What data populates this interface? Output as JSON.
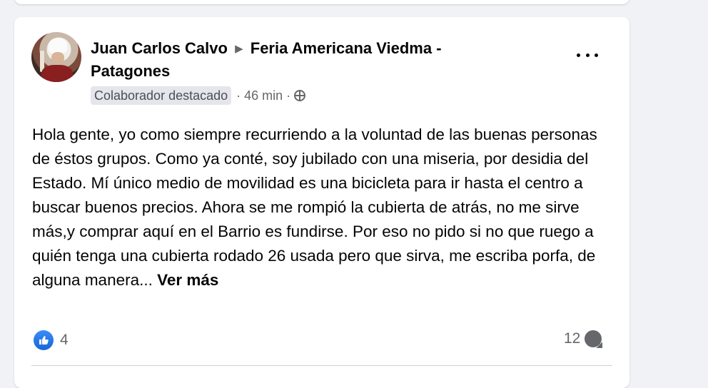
{
  "post": {
    "author": "Juan Carlos Calvo",
    "group": "Feria Americana Viedma - Patagones",
    "badge": "Colaborador destacado",
    "time": "· 46 min ·",
    "body": "Hola gente, yo como siempre recurriendo a la voluntad de las buenas personas de éstos grupos. Como ya conté, soy jubilado con una miseria, por desidia del Estado. Mí único medio de movilidad es una bicicleta para ir hasta el centro a buscar buenos precios. Ahora se me rompió la cubierta de atrás, no me sirve más,y comprar aquí en el Barrio es fundirse. Por eso no pido si no que ruego a quién tenga una cubierta rodado 26 usada pero que sirva, me escriba porfa, de alguna manera... ",
    "see_more": "Ver más",
    "reactions_count": "4",
    "comments_count": "12"
  },
  "icons": {
    "audience": "globe-icon",
    "reaction": "like-icon",
    "comments": "comment-icon",
    "menu": "more-options-icon",
    "separator": "triangle-right-icon"
  },
  "colors": {
    "like_blue": "#1877f2",
    "secondary_text": "#65676b",
    "badge_bg": "#e4e6eb"
  }
}
